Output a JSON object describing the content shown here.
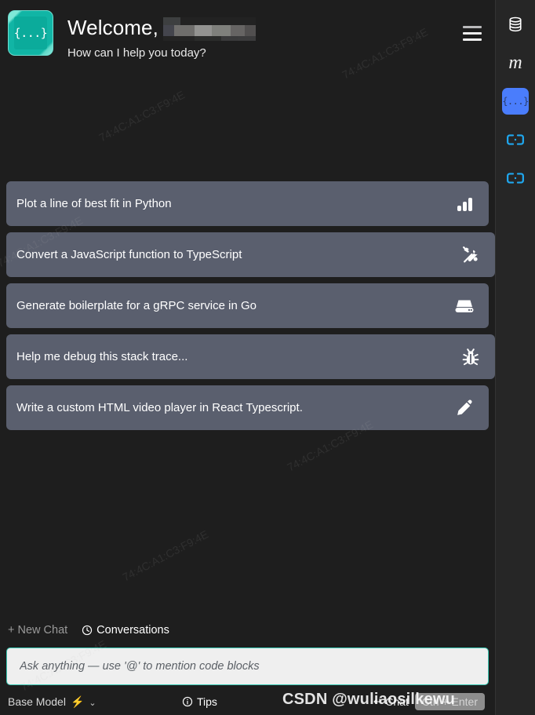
{
  "header": {
    "logo_glyph": "{...}",
    "logo_name": "code-braces-logo",
    "welcome": "Welcome,",
    "username_redacted": "",
    "subtitle": "How can I help you today?",
    "menu_name": "hamburger-menu"
  },
  "suggestions": [
    {
      "label": "Plot a line of best fit in Python",
      "icon": "bar-chart-icon"
    },
    {
      "label": "Convert a JavaScript function to TypeScript",
      "icon": "tools-icon"
    },
    {
      "label": "Generate boilerplate for a gRPC service in Go",
      "icon": "server-icon"
    },
    {
      "label": "Help me debug this stack trace...",
      "icon": "bug-icon"
    },
    {
      "label": "Write a custom HTML video player in React Typescript.",
      "icon": "pencil-icon"
    }
  ],
  "quick_actions": {
    "new_chat": "+ New Chat",
    "conversations": "Conversations"
  },
  "composer": {
    "placeholder": "Ask anything — use '@' to mention code blocks",
    "value": ""
  },
  "status_bar": {
    "model": "Base Model",
    "bolt": "⚡",
    "chevron": "⌄",
    "tips": "Tips",
    "send_mode": "Chat",
    "send_key": "Ctrl + Enter"
  },
  "sidebar": {
    "items": [
      {
        "name": "database-icon",
        "label": ""
      },
      {
        "name": "markdown-m-icon",
        "label": "m"
      },
      {
        "name": "code-braces-icon",
        "label": "{...}"
      },
      {
        "name": "link-icon",
        "label": ""
      },
      {
        "name": "link-icon",
        "label": ""
      }
    ]
  },
  "watermark": {
    "overlay": "CSDN @wuliaosilkewu",
    "tiles": [
      "74:4C:A1:C3:F9:4E",
      "74:4C:A1:C3:F9:4E",
      "74:4C:A1:C3:F9:4E",
      "74:4C:A1:C3:F9:4E",
      "74:4C:A1:C3:F9:4E",
      "74:4C:A1:C3:F9:4E"
    ]
  },
  "colors": {
    "background": "#1e1e1e",
    "card": "#5a5f6e",
    "accent_teal": "#11b5a5",
    "accent_blue": "#4a7dfc",
    "link_cyan": "#1fa8f0",
    "bolt_yellow": "#f0b429"
  }
}
